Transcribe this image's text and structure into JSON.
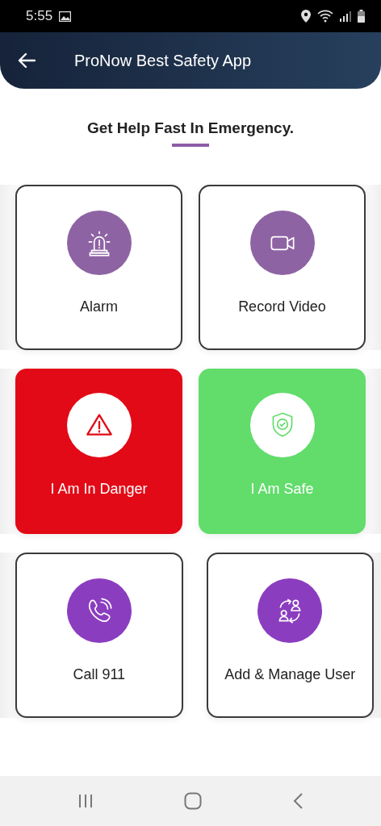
{
  "status_bar": {
    "time": "5:55"
  },
  "app_bar": {
    "title": "ProNow Best Safety App"
  },
  "heading": "Get Help Fast In Emergency.",
  "rows": [
    {
      "cards": [
        {
          "label": "Alarm",
          "kind": "outline",
          "color": "#8e63a3"
        },
        {
          "label": "Record Video",
          "kind": "outline",
          "color": "#8e63a3"
        }
      ]
    },
    {
      "cards": [
        {
          "label": "I Am In Danger",
          "kind": "filled",
          "color": "#e20a16"
        },
        {
          "label": "I Am Safe",
          "kind": "filled",
          "color": "#62dc6b"
        }
      ]
    },
    {
      "cards": [
        {
          "label": "Call 911",
          "kind": "outline",
          "color": "#8b3dbf"
        },
        {
          "label": "Add & Manage User",
          "kind": "outline",
          "color": "#8b3dbf"
        }
      ]
    }
  ]
}
